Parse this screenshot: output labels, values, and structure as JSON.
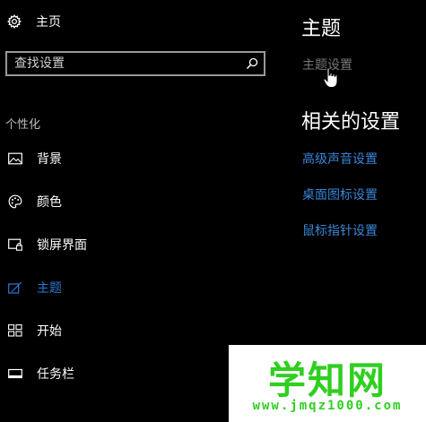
{
  "sidebar": {
    "home_label": "主页",
    "search": {
      "placeholder": "查找设置",
      "value": ""
    },
    "section_label": "个性化",
    "items": [
      {
        "label": "背景",
        "icon": "picture-icon"
      },
      {
        "label": "颜色",
        "icon": "palette-icon"
      },
      {
        "label": "锁屏界面",
        "icon": "lock-screen-icon"
      },
      {
        "label": "主题",
        "icon": "theme-icon",
        "active": true
      },
      {
        "label": "开始",
        "icon": "start-icon"
      },
      {
        "label": "任务栏",
        "icon": "taskbar-icon"
      }
    ]
  },
  "main": {
    "title": "主题",
    "theme_settings_link": "主题设置",
    "related_heading": "相关的设置",
    "related_links": [
      "高级声音设置",
      "桌面图标设置",
      "鼠标指针设置"
    ]
  },
  "watermark": {
    "text": "学知网",
    "url": "www.jmqz1000.com"
  },
  "colors": {
    "background": "#000000",
    "accent": "#2b78d6",
    "link": "#3a86d8",
    "watermark": "#2fcf1f"
  }
}
